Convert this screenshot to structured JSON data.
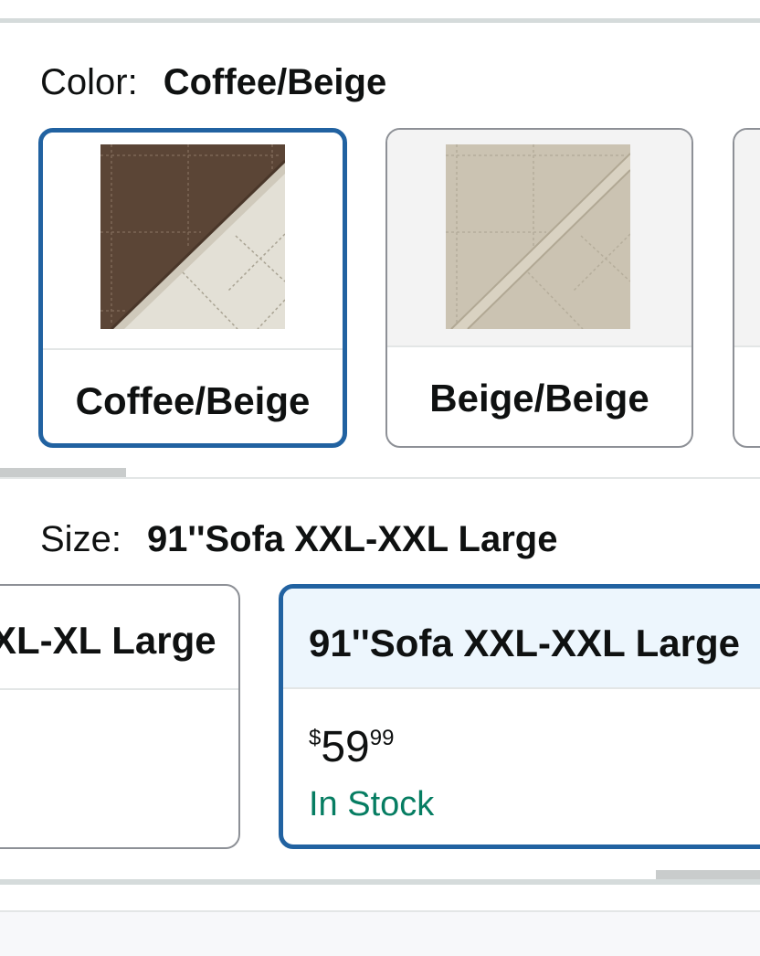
{
  "color": {
    "label": "Color:",
    "selected_value": "Coffee/Beige",
    "options": [
      {
        "name": "Coffee/Beige",
        "selected": true,
        "image": "coffee-beige-swatch-image"
      },
      {
        "name": "Beige/Beige",
        "selected": false,
        "image": "beige-beige-swatch-image"
      }
    ]
  },
  "size": {
    "label": "Size:",
    "selected_value": "91''Sofa XXL-XXL Large",
    "options": [
      {
        "name": "XL-XL Large",
        "selected": false
      },
      {
        "name": "91''Sofa XXL-XXL Large",
        "selected": true,
        "price": {
          "symbol": "$",
          "whole": "59",
          "fraction": "99"
        },
        "availability": "In Stock"
      }
    ]
  },
  "colors": {
    "selected_border": "#2162a1",
    "unselected_border": "#8d9096",
    "in_stock": "#067d62",
    "selected_header_bg": "#edf6fd"
  }
}
